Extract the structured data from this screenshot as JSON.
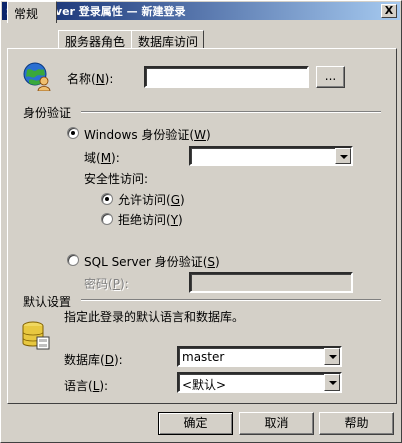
{
  "window": {
    "title": "SQL Server 登录属性 — 新建登录",
    "close_glyph": "X"
  },
  "tabs": [
    {
      "label": "常规"
    },
    {
      "label": "服务器角色"
    },
    {
      "label": "数据库访问"
    }
  ],
  "general": {
    "name_label_prefix": "名称(",
    "name_label_key": "N",
    "name_label_suffix": "):",
    "name_value": "",
    "browse_button": "...",
    "auth_section": "身份验证",
    "windows_auth_prefix": "Windows 身份验证(",
    "windows_auth_key": "W",
    "windows_auth_suffix": ")",
    "domain_prefix": "域(",
    "domain_key": "M",
    "domain_suffix": "):",
    "domain_value": "",
    "security_access_label": "安全性访问:",
    "grant_prefix": "允许访问(",
    "grant_key": "G",
    "grant_suffix": ")",
    "deny_prefix": "拒绝访问(",
    "deny_key": "Y",
    "deny_suffix": ")",
    "sql_auth_prefix": "SQL Server 身份验证(",
    "sql_auth_key": "S",
    "sql_auth_suffix": ")",
    "password_prefix": "密码(",
    "password_key": "P",
    "password_suffix": "):",
    "defaults_section": "默认设置",
    "defaults_desc": "指定此登录的默认语言和数据库。",
    "database_prefix": "数据库(",
    "database_key": "D",
    "database_suffix": "):",
    "database_value": "master",
    "language_prefix": "语言(",
    "language_key": "L",
    "language_suffix": "):",
    "language_value": "<默认>"
  },
  "buttons": {
    "ok": "确定",
    "cancel": "取消",
    "help": "帮助"
  }
}
